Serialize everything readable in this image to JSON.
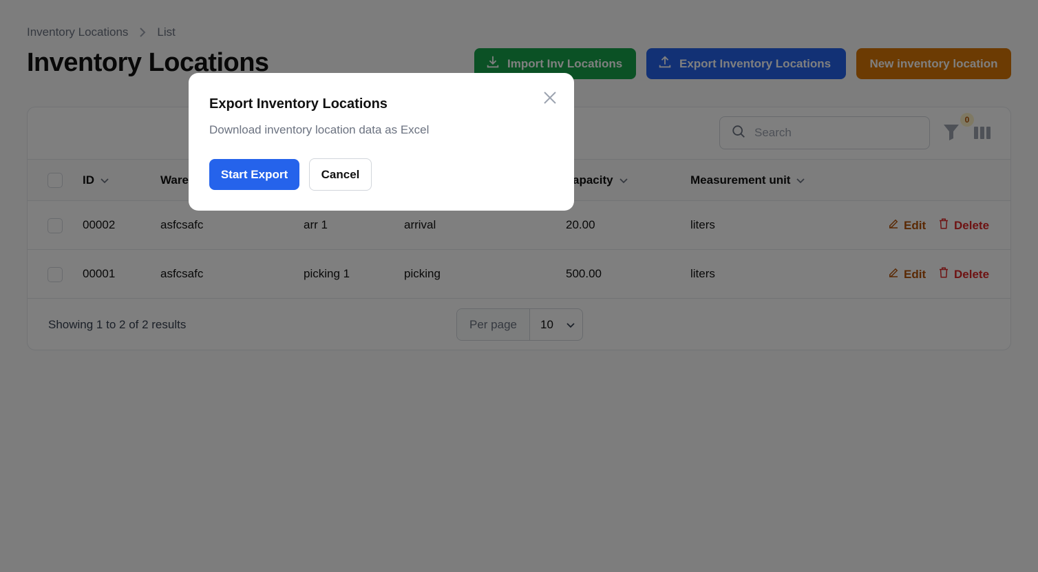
{
  "breadcrumb": {
    "parent": "Inventory Locations",
    "current": "List"
  },
  "page": {
    "title": "Inventory Locations"
  },
  "header_actions": {
    "import_label": "Import Inv Locations",
    "export_label": "Export Inventory Locations",
    "new_label": "New inventory location"
  },
  "toolbar": {
    "search_placeholder": "Search",
    "filter_count": "0"
  },
  "table": {
    "columns": [
      "ID",
      "Ware",
      "apacity",
      "Measurement unit"
    ],
    "rows": [
      {
        "id": "00002",
        "warehouse": "asfcsafc",
        "name": "arr 1",
        "type": "arrival",
        "capacity": "20.00",
        "unit": "liters",
        "edit": "Edit",
        "delete": "Delete"
      },
      {
        "id": "00001",
        "warehouse": "asfcsafc",
        "name": "picking 1",
        "type": "picking",
        "capacity": "500.00",
        "unit": "liters",
        "edit": "Edit",
        "delete": "Delete"
      }
    ]
  },
  "footer": {
    "summary": "Showing 1 to 2 of 2 results",
    "per_page_label": "Per page",
    "per_page_value": "10"
  },
  "modal": {
    "title": "Export Inventory Locations",
    "description": "Download inventory location data as Excel",
    "start_label": "Start Export",
    "cancel_label": "Cancel"
  },
  "colors": {
    "primary": "#2563eb",
    "success": "#16a34a",
    "warning": "#d97706",
    "danger": "#dc2626"
  }
}
